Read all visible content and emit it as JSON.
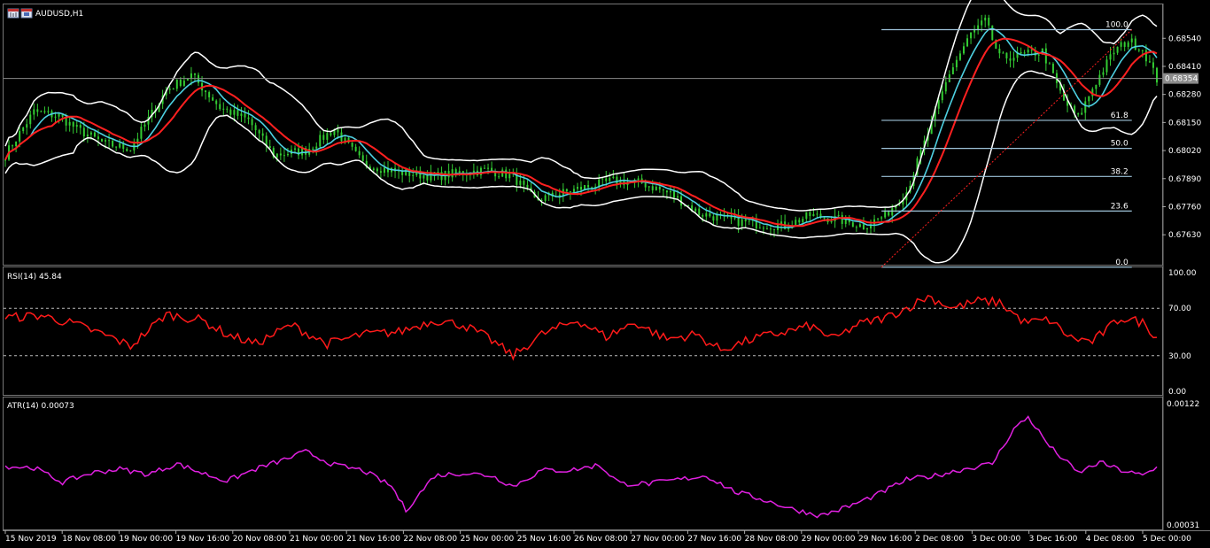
{
  "chart_title": "AUDUSD,H1",
  "current_price": "0.68354",
  "colors": {
    "background": "#000000",
    "candle": "#33cc33",
    "bands": "#ffffff",
    "ma_fast": "#4dd0e1",
    "ma_slow": "#ff2020",
    "rsi": "#ff1a1a",
    "atr": "#e020e0",
    "fib": "#9ec3d9",
    "trend": "#ff2020"
  },
  "icons": [
    "chart-window-icon",
    "chart-properties-icon"
  ],
  "chart_data": [
    {
      "type": "candlestick",
      "title": "AUDUSD,H1",
      "y_ticks": [
        "0.68540",
        "0.68410",
        "0.68280",
        "0.68150",
        "0.68020",
        "0.67890",
        "0.67760",
        "0.67630"
      ],
      "ylim": [
        0.6752,
        0.6866
      ],
      "current_price": 0.68354,
      "x_ticks": [
        "15 Nov 2019",
        "18 Nov 08:00",
        "19 Nov 00:00",
        "19 Nov 16:00",
        "20 Nov 08:00",
        "21 Nov 00:00",
        "21 Nov 16:00",
        "22 Nov 08:00",
        "25 Nov 00:00",
        "25 Nov 16:00",
        "26 Nov 08:00",
        "27 Nov 00:00",
        "27 Nov 16:00",
        "28 Nov 08:00",
        "29 Nov 00:00",
        "29 Nov 16:00",
        "2 Dec 08:00",
        "3 Dec 00:00",
        "3 Dec 16:00",
        "4 Dec 08:00",
        "5 Dec 00:00"
      ],
      "close_keypoints": [
        [
          0,
          0.68
        ],
        [
          8,
          0.682
        ],
        [
          15,
          0.6818
        ],
        [
          20,
          0.6812
        ],
        [
          28,
          0.6805
        ],
        [
          35,
          0.6803
        ],
        [
          45,
          0.683
        ],
        [
          52,
          0.6837
        ],
        [
          60,
          0.6822
        ],
        [
          68,
          0.6816
        ],
        [
          75,
          0.68
        ],
        [
          84,
          0.6802
        ],
        [
          92,
          0.6812
        ],
        [
          100,
          0.6796
        ],
        [
          110,
          0.6792
        ],
        [
          120,
          0.679
        ],
        [
          128,
          0.6792
        ],
        [
          135,
          0.6793
        ],
        [
          142,
          0.679
        ],
        [
          148,
          0.6779
        ],
        [
          155,
          0.6782
        ],
        [
          162,
          0.6785
        ],
        [
          170,
          0.6788
        ],
        [
          178,
          0.6787
        ],
        [
          186,
          0.6782
        ],
        [
          194,
          0.6773
        ],
        [
          202,
          0.677
        ],
        [
          210,
          0.6768
        ],
        [
          218,
          0.6767
        ],
        [
          225,
          0.6772
        ],
        [
          233,
          0.677
        ],
        [
          240,
          0.6767
        ],
        [
          246,
          0.6772
        ],
        [
          252,
          0.6783
        ],
        [
          258,
          0.681
        ],
        [
          264,
          0.6838
        ],
        [
          270,
          0.6856
        ],
        [
          274,
          0.6862
        ],
        [
          278,
          0.6845
        ],
        [
          284,
          0.6846
        ],
        [
          290,
          0.6848
        ],
        [
          296,
          0.6825
        ],
        [
          300,
          0.6817
        ],
        [
          304,
          0.6831
        ],
        [
          310,
          0.6848
        ],
        [
          314,
          0.6853
        ],
        [
          318,
          0.6849
        ],
        [
          322,
          0.6835
        ]
      ],
      "fibonacci": [
        {
          "level": "100.0",
          "price": 0.6858
        },
        {
          "level": "61.8",
          "price": 0.6816
        },
        {
          "level": "50.0",
          "price": 0.6803
        },
        {
          "level": "38.2",
          "price": 0.679
        },
        {
          "level": "23.6",
          "price": 0.6774
        },
        {
          "level": "0.0",
          "price": 0.6748
        }
      ]
    },
    {
      "type": "line",
      "title": "RSI(14) 45.84",
      "y_ticks": [
        "100.00",
        "70.00",
        "30.00",
        "0.00"
      ],
      "ylim": [
        0,
        100
      ],
      "levels": [
        70,
        30
      ],
      "keypoints": [
        [
          0,
          62
        ],
        [
          10,
          64
        ],
        [
          20,
          56
        ],
        [
          30,
          45
        ],
        [
          35,
          38
        ],
        [
          45,
          65
        ],
        [
          55,
          60
        ],
        [
          62,
          48
        ],
        [
          70,
          40
        ],
        [
          80,
          56
        ],
        [
          90,
          40
        ],
        [
          100,
          48
        ],
        [
          110,
          50
        ],
        [
          120,
          60
        ],
        [
          128,
          56
        ],
        [
          135,
          45
        ],
        [
          142,
          30
        ],
        [
          150,
          48
        ],
        [
          160,
          60
        ],
        [
          168,
          46
        ],
        [
          176,
          58
        ],
        [
          185,
          44
        ],
        [
          193,
          48
        ],
        [
          200,
          35
        ],
        [
          210,
          45
        ],
        [
          218,
          50
        ],
        [
          225,
          55
        ],
        [
          232,
          44
        ],
        [
          238,
          56
        ],
        [
          246,
          62
        ],
        [
          252,
          70
        ],
        [
          258,
          80
        ],
        [
          265,
          70
        ],
        [
          272,
          76
        ],
        [
          278,
          75
        ],
        [
          285,
          58
        ],
        [
          292,
          60
        ],
        [
          298,
          45
        ],
        [
          304,
          42
        ],
        [
          312,
          62
        ],
        [
          318,
          58
        ],
        [
          322,
          46
        ]
      ]
    },
    {
      "type": "line",
      "title": "ATR(14) 0.00073",
      "y_ticks": [
        "0.00122",
        "0.00031"
      ],
      "ylim": [
        0.00031,
        0.00122
      ],
      "keypoints": [
        [
          0,
          0.00075
        ],
        [
          8,
          0.00074
        ],
        [
          16,
          0.00063
        ],
        [
          24,
          0.0007
        ],
        [
          32,
          0.00073
        ],
        [
          40,
          0.00069
        ],
        [
          48,
          0.00077
        ],
        [
          55,
          0.0007
        ],
        [
          62,
          0.00064
        ],
        [
          70,
          0.00073
        ],
        [
          78,
          0.0008
        ],
        [
          84,
          0.00086
        ],
        [
          92,
          0.00076
        ],
        [
          100,
          0.00072
        ],
        [
          108,
          0.0006
        ],
        [
          112,
          0.00042
        ],
        [
          120,
          0.00068
        ],
        [
          128,
          0.0007
        ],
        [
          136,
          0.00068
        ],
        [
          142,
          0.0006
        ],
        [
          150,
          0.00072
        ],
        [
          158,
          0.00072
        ],
        [
          166,
          0.00076
        ],
        [
          172,
          0.00062
        ],
        [
          180,
          0.00062
        ],
        [
          188,
          0.00065
        ],
        [
          196,
          0.00068
        ],
        [
          204,
          0.00056
        ],
        [
          212,
          0.0005
        ],
        [
          220,
          0.00043
        ],
        [
          228,
          0.00038
        ],
        [
          236,
          0.00045
        ],
        [
          244,
          0.00054
        ],
        [
          252,
          0.00065
        ],
        [
          260,
          0.00068
        ],
        [
          268,
          0.00073
        ],
        [
          276,
          0.00077
        ],
        [
          282,
          0.00103
        ],
        [
          286,
          0.00112
        ],
        [
          292,
          0.0009
        ],
        [
          300,
          0.0007
        ],
        [
          306,
          0.00078
        ],
        [
          312,
          0.00072
        ],
        [
          318,
          0.00068
        ],
        [
          322,
          0.00074
        ]
      ]
    }
  ]
}
